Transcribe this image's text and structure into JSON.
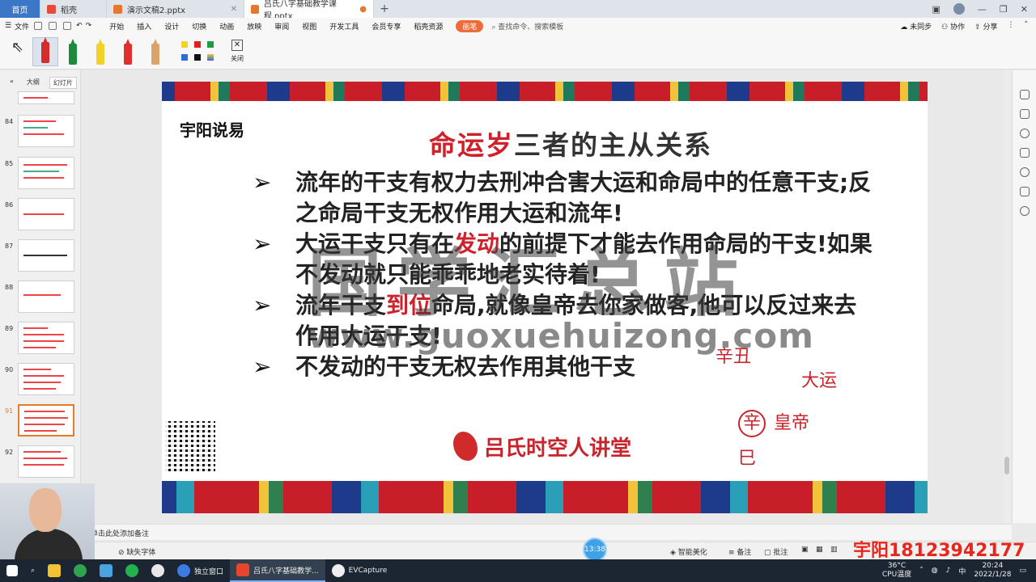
{
  "tabs": {
    "home": "首页",
    "items": [
      {
        "label": "稻壳"
      },
      {
        "label": "演示文稿2.pptx"
      },
      {
        "label": "吕氏八字基础教学课程.pptx"
      }
    ]
  },
  "menu": {
    "file": "文件",
    "items": [
      "开始",
      "插入",
      "设计",
      "切换",
      "动画",
      "放映",
      "审阅",
      "视图",
      "开发工具",
      "会员专享",
      "稻壳资源"
    ],
    "pen_pill": "画笔",
    "search": "查找命令、搜索模板",
    "right": [
      "未同步",
      "协作",
      "分享"
    ]
  },
  "pen_toolbar": {
    "close_label": "关闭"
  },
  "left_panel": {
    "tab_outline": "大纲",
    "tab_slides": "幻灯片",
    "slides": [
      "84",
      "85",
      "86",
      "87",
      "88",
      "89",
      "90",
      "91",
      "92"
    ],
    "selected": "91"
  },
  "slide": {
    "brand": "宇阳说易",
    "title_red": "命运岁",
    "title_rest": "三者的主从关系",
    "bullets": [
      {
        "text": "流年的干支有权力去刑冲合害大运和命局中的任意干支;反之命局干支无权作用大运和流年!"
      },
      {
        "pre": "大运干支只有在",
        "hl": "发动",
        "post": "的前提下才能去作用命局的干支!如果不发动就只能乖乖地老实待着!"
      },
      {
        "pre": "流年干支",
        "hl": "到位",
        "post": "命局,就像皇帝去你家做客,他可以反过来去作用大运干支!"
      },
      {
        "text": "不发动的干支无权去作用其他干支"
      }
    ],
    "bullet_marker": "➢",
    "watermark": "国学汇总站",
    "watermark_url": "www.guoxuehuizong.com",
    "footer": "吕氏时空人讲堂",
    "handwriting": {
      "a": "辛丑",
      "b": "辛",
      "c": "巳",
      "d": "皇帝",
      "e": "大运"
    }
  },
  "notes": {
    "placeholder": "单击此处添加备注"
  },
  "statusbar": {
    "missing_font": "缺失字体",
    "smart": "智能美化",
    "notes": "备注",
    "comment": "批注",
    "timer": "13:38",
    "phone": "宇阳18123942177"
  },
  "taskbar": {
    "items": [
      "独立窗口",
      "吕氏八字基础教学...",
      "EVCapture"
    ],
    "temp": "36°C",
    "cpu": "CPU温度",
    "time": "20:24",
    "date": "2022/1/28"
  },
  "colors": {
    "accent_red": "#d0212a",
    "wps_orange": "#ef6c3a",
    "home_blue": "#3b76c7"
  }
}
